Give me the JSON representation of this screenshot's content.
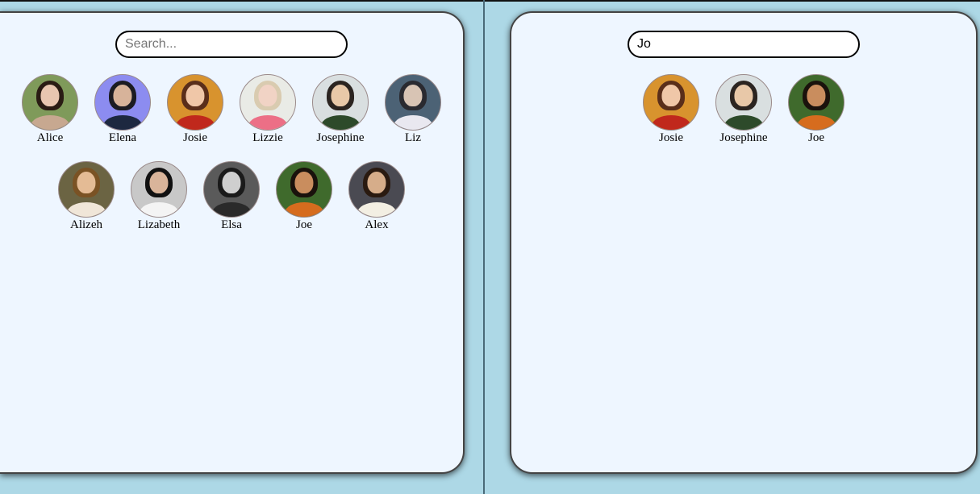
{
  "left": {
    "search": {
      "placeholder": "Search...",
      "value": ""
    },
    "people": [
      {
        "name": "Alice",
        "bg": "#7f9a5a",
        "skin": "#e8c6b0",
        "hair": "#2a1c14",
        "shirt": "#c7a890"
      },
      {
        "name": "Elena",
        "bg": "#8c8cf0",
        "skin": "#d7b39a",
        "hair": "#1b1b22",
        "shirt": "#1d2840"
      },
      {
        "name": "Josie",
        "bg": "#d8932e",
        "skin": "#f0c7a8",
        "hair": "#5a2e1a",
        "shirt": "#c0281c"
      },
      {
        "name": "Lizzie",
        "bg": "#e9ebe6",
        "skin": "#f1d3c5",
        "hair": "#d9cbb0",
        "shirt": "#ec6f86"
      },
      {
        "name": "Josephine",
        "bg": "#d9dfe0",
        "skin": "#e8c8a8",
        "hair": "#2b2420",
        "shirt": "#2d4a2a"
      },
      {
        "name": "Liz",
        "bg": "#4c6275",
        "skin": "#d8c4b4",
        "hair": "#2a2a30",
        "shirt": "#e9e8f0"
      },
      {
        "name": "Alizeh",
        "bg": "#6b6443",
        "skin": "#e4bb95",
        "hair": "#7a5224",
        "shirt": "#f0e6d8"
      },
      {
        "name": "Lizabeth",
        "bg": "#c8c8c8",
        "skin": "#d9b49a",
        "hair": "#111111",
        "shirt": "#f4f4f4"
      },
      {
        "name": "Elsa",
        "bg": "#5a5a5a",
        "skin": "#cfcfcf",
        "hair": "#1a1a1a",
        "shirt": "#2a2a2a"
      },
      {
        "name": "Joe",
        "bg": "#3f6a2c",
        "skin": "#c98d5e",
        "hair": "#1a120c",
        "shirt": "#d66c1e"
      },
      {
        "name": "Alex",
        "bg": "#4a4a52",
        "skin": "#d6ad8a",
        "hair": "#2a1a10",
        "shirt": "#f3efe3"
      }
    ]
  },
  "right": {
    "search": {
      "placeholder": "Search...",
      "value": "Jo"
    },
    "people": [
      {
        "name": "Josie",
        "bg": "#d8932e",
        "skin": "#f0c7a8",
        "hair": "#5a2e1a",
        "shirt": "#c0281c"
      },
      {
        "name": "Josephine",
        "bg": "#d9dfe0",
        "skin": "#e8c8a8",
        "hair": "#2b2420",
        "shirt": "#2d4a2a"
      },
      {
        "name": "Joe",
        "bg": "#3f6a2c",
        "skin": "#c98d5e",
        "hair": "#1a120c",
        "shirt": "#d66c1e"
      }
    ]
  }
}
